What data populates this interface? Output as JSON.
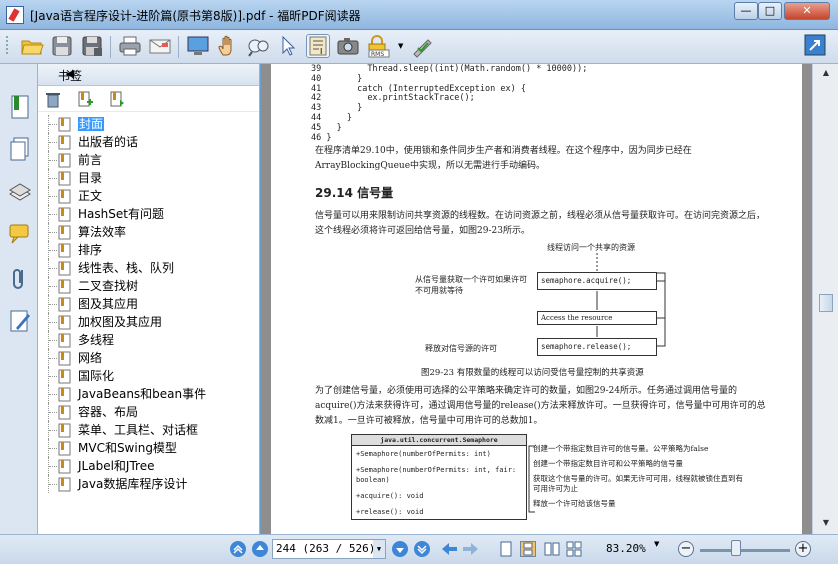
{
  "window": {
    "title": "[Java语言程序设计-进阶篇(原书第8版)].pdf - 福昕PDF阅读器",
    "min_label": "—",
    "max_label": "□",
    "close_label": "✕"
  },
  "toolbar": {
    "icons": [
      "open-icon",
      "save-icon",
      "save-as-icon",
      "print-icon",
      "email-icon",
      "fullscreen-icon",
      "hand-icon",
      "zoom-icon",
      "select-icon",
      "text-select-icon",
      "snapshot-icon",
      "rms-icon",
      "signature-icon"
    ],
    "rms_label": "RMS"
  },
  "bookmarks": {
    "panel_title": "书签",
    "collapse_glyph": "◀",
    "items": [
      {
        "label": "封面",
        "selected": true
      },
      {
        "label": "出版者的话"
      },
      {
        "label": "前言"
      },
      {
        "label": "目录"
      },
      {
        "label": "正文"
      },
      {
        "label": "HashSet有问题"
      },
      {
        "label": "算法效率"
      },
      {
        "label": "排序"
      },
      {
        "label": "线性表、栈、队列"
      },
      {
        "label": "二叉查找树"
      },
      {
        "label": "图及其应用"
      },
      {
        "label": "加权图及其应用"
      },
      {
        "label": "多线程"
      },
      {
        "label": "网络"
      },
      {
        "label": "国际化"
      },
      {
        "label": "JavaBeans和bean事件"
      },
      {
        "label": "容器、布局"
      },
      {
        "label": "菜单、工具栏、对话框"
      },
      {
        "label": "MVC和Swing模型"
      },
      {
        "label": "JLabel和JTree"
      },
      {
        "label": "Java数据库程序设计"
      }
    ]
  },
  "document": {
    "code_lines": [
      {
        "n": "39",
        "code": "        Thread.sleep((int)(Math.random() * 10000));"
      },
      {
        "n": "40",
        "code": "      }"
      },
      {
        "n": "41",
        "code": "      catch (InterruptedException ex) {"
      },
      {
        "n": "42",
        "code": "        ex.printStackTrace();"
      },
      {
        "n": "43",
        "code": "      }"
      },
      {
        "n": "44",
        "code": "    }"
      },
      {
        "n": "45",
        "code": "  }"
      },
      {
        "n": "46",
        "code": "}"
      }
    ],
    "para1": "在程序清单29.10中，使用锁和条件同步生产者和消费者线程。在这个程序中，因为同步已经在ArrayBlockingQueue中实现，所以无需进行手动编码。",
    "section_heading": "29.14  信号量",
    "para2": "信号量可以用来限制访问共享资源的线程数。在访问资源之前，线程必须从信号量获取许可。在访问完资源之后，这个线程必须将许可返回给信号量，如图29-23所示。",
    "fig": {
      "top_label": "线程访问一个共享的资源",
      "left1": "从信号量获取一个许可如果许可不可用就等待",
      "box1": "semaphore.acquire();",
      "box2": "Access the resource",
      "left3": "释放对信号源的许可",
      "box3": "semaphore.release();",
      "caption": "图29-23   有限数量的线程可以访问受信号量控制的共享资源"
    },
    "para3": "为了创建信号量，必须使用可选择的公平策略来确定许可的数量，如图29-24所示。任务通过调用信号量的acquire()方法来获得许可，通过调用信号量的release()方法来释放许可。一旦获得许可，信号量中可用许可的总数减1。一旦许可被释放，信号量中可用许可的总数加1。",
    "uml": {
      "class_name": "java.util.concurrent.Semaphore",
      "methods": [
        "+Semaphore(numberOfPermits: int)",
        "+Semaphore(numberOfPermits: int, fair: boolean)",
        "+acquire(): void",
        "+release(): void"
      ],
      "notes": [
        "创建一个带指定数目许可的信号量。公平策略为false",
        "创建一个带指定数目许可和公平策略的信号量",
        "获取这个信号量的许可。如果无许可可用，线程就被锁住直到有可用许可为止",
        "释放一个许可给该信号量"
      ]
    }
  },
  "statusbar": {
    "page_field": "244 (263 / 526)",
    "zoom": "83.20%",
    "zoom_minus": "−",
    "zoom_plus": "+",
    "slider_level": 0.4
  },
  "colors": {
    "selection": "#3399ff",
    "titlebar": "#a9c8ea",
    "doc_background": "#8e8e8e"
  }
}
